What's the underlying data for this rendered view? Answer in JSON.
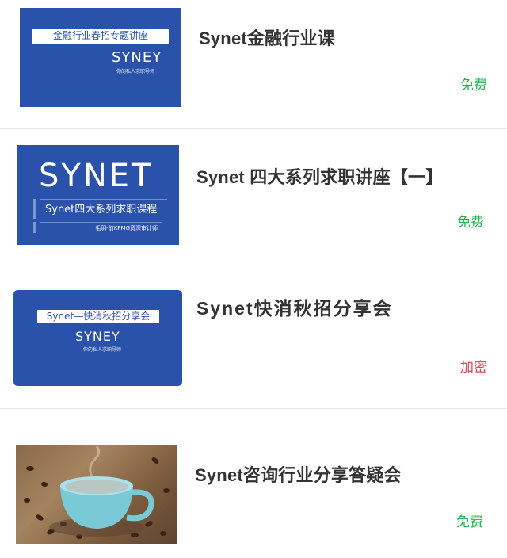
{
  "items": [
    {
      "title": "Synet金融行业课",
      "badge": "免费",
      "thumb": {
        "banner": "金融行业春招专题讲座",
        "logo": "SYNEY",
        "tagline": "你的私人求职导师"
      }
    },
    {
      "title": "Synet 四大系列求职讲座【一】",
      "badge": "免费",
      "thumb": {
        "logo": "SYNET",
        "bar": "Synet四大系列求职课程",
        "sub": "毛玥-前KPMG资深审计师"
      }
    },
    {
      "title": "Synet快消秋招分享会",
      "badge": "加密",
      "thumb": {
        "banner": "Synet—快消秋招分享会",
        "logo": "SYNEY",
        "tagline": "你的私人求职导师"
      }
    },
    {
      "title": "Synet咨询行业分享答疑会",
      "badge": "免费",
      "thumb": {
        "image": "coffee-cup-photo"
      }
    }
  ],
  "colors": {
    "free": "#22b14c",
    "locked": "#e0455f",
    "brand_blue": "#2a52ab"
  }
}
